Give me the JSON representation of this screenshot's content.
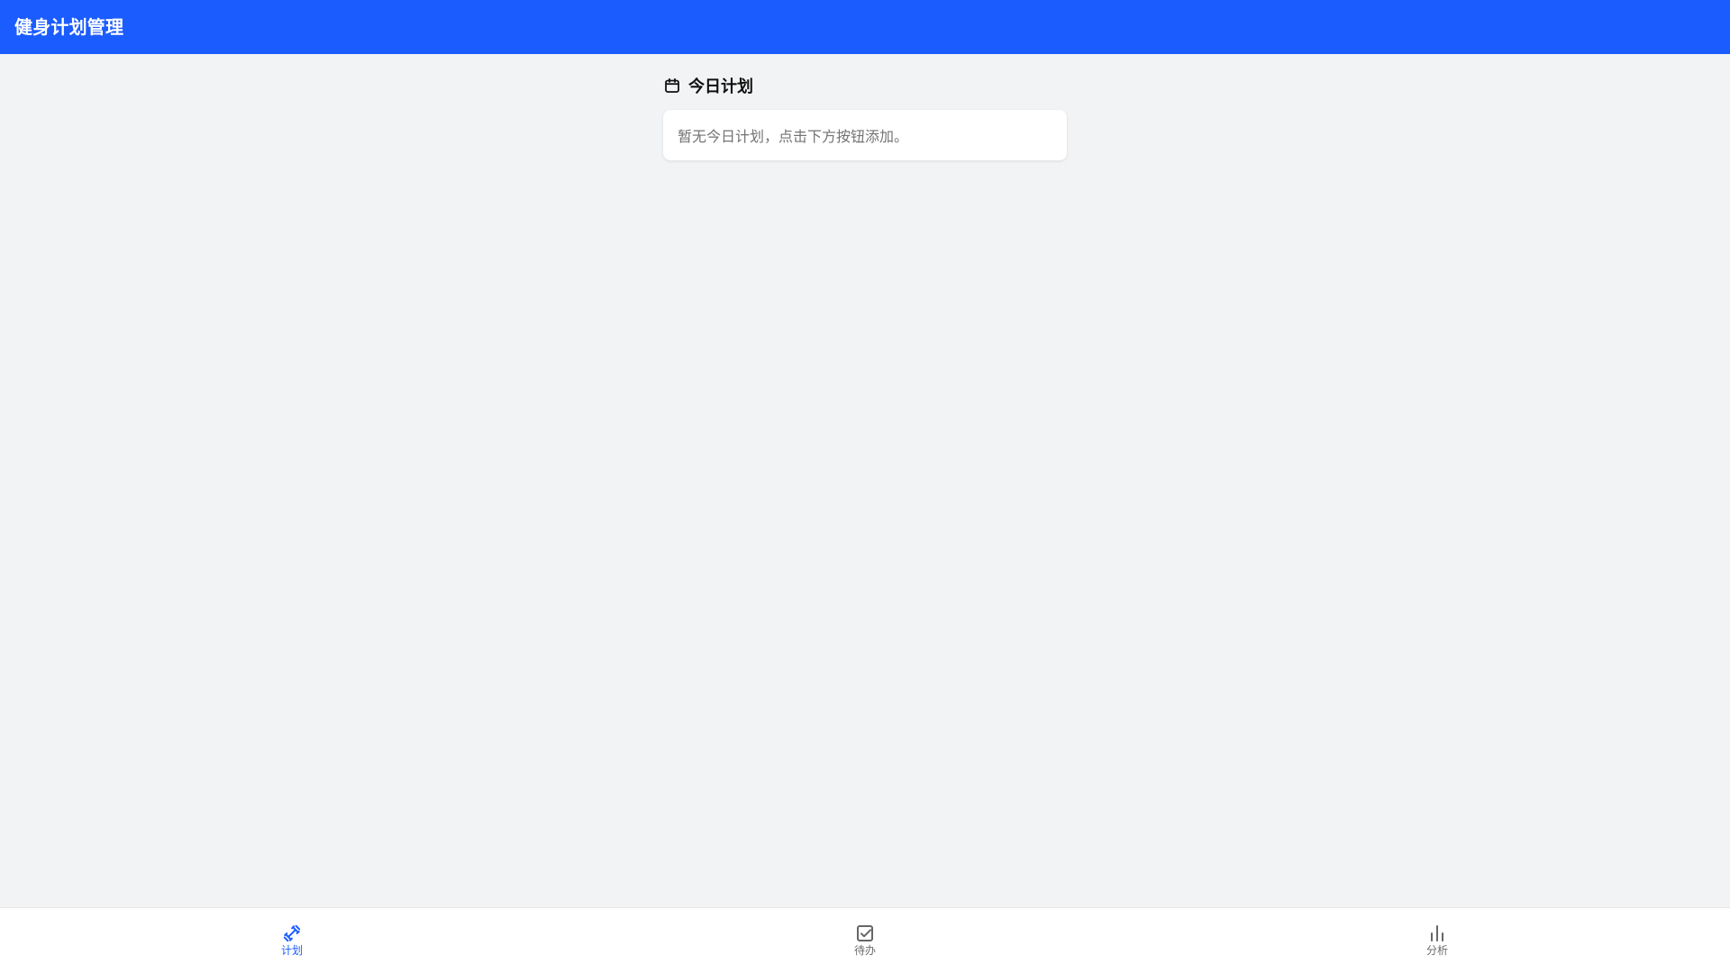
{
  "header": {
    "title": "健身计划管理"
  },
  "main": {
    "section_title": "今日计划",
    "empty_message": "暂无今日计划，点击下方按钮添加。"
  },
  "nav": {
    "items": [
      {
        "label": "计划",
        "icon": "dumbbell-icon",
        "active": true
      },
      {
        "label": "待办",
        "icon": "checkbox-icon",
        "active": false
      },
      {
        "label": "分析",
        "icon": "bar-chart-icon",
        "active": false
      }
    ]
  },
  "colors": {
    "primary": "#1a5cff",
    "background": "#f2f3f5",
    "card": "#ffffff",
    "muted_text": "#737373",
    "nav_text": "#6b6b6b"
  }
}
